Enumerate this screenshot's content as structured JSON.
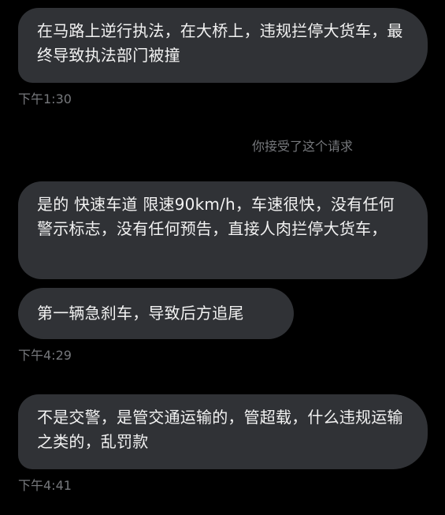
{
  "conversation": {
    "messages": [
      {
        "text": "在马路上逆行执法，在大桥上，违规拦停大货车，最终导致执法部门被撞",
        "time": "下午1:30"
      },
      {
        "text": "是的 快速车道 限速90km/h，车速很快，没有任何警示标志，没有任何预告，直接人肉拦停大货车，"
      },
      {
        "text": "第一辆急刹车，导致后方追尾",
        "time": "下午4:29"
      },
      {
        "text": "不是交警，是管交通运输的，管超载，什么违规运输之类的，乱罚款",
        "time": "下午4:41"
      }
    ],
    "system_note": "你接受了这个请求"
  }
}
